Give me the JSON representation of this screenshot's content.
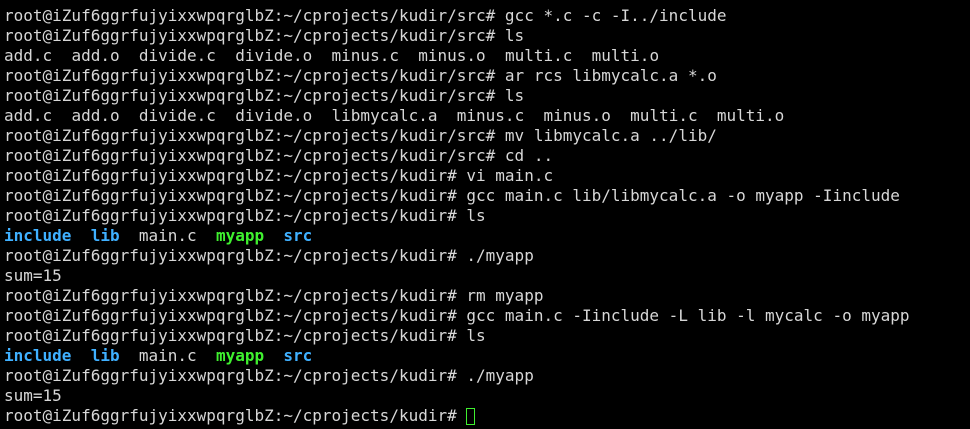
{
  "terminal": {
    "lines": [
      {
        "kind": "cmd",
        "prompt": "root@iZuf6ggrfujyixxwpqrglbZ:~/cprojects/kudir/src#",
        "command": "gcc *.c -c -I../include"
      },
      {
        "kind": "cmd",
        "prompt": "root@iZuf6ggrfujyixxwpqrglbZ:~/cprojects/kudir/src#",
        "command": "ls"
      },
      {
        "kind": "ls",
        "items": [
          {
            "text": "add.c",
            "type": "file"
          },
          {
            "text": "add.o",
            "type": "file"
          },
          {
            "text": "divide.c",
            "type": "file"
          },
          {
            "text": "divide.o",
            "type": "file"
          },
          {
            "text": "minus.c",
            "type": "file"
          },
          {
            "text": "minus.o",
            "type": "file"
          },
          {
            "text": "multi.c",
            "type": "file"
          },
          {
            "text": "multi.o",
            "type": "file"
          }
        ]
      },
      {
        "kind": "cmd",
        "prompt": "root@iZuf6ggrfujyixxwpqrglbZ:~/cprojects/kudir/src#",
        "command": "ar rcs libmycalc.a *.o"
      },
      {
        "kind": "cmd",
        "prompt": "root@iZuf6ggrfujyixxwpqrglbZ:~/cprojects/kudir/src#",
        "command": "ls"
      },
      {
        "kind": "ls",
        "items": [
          {
            "text": "add.c",
            "type": "file"
          },
          {
            "text": "add.o",
            "type": "file"
          },
          {
            "text": "divide.c",
            "type": "file"
          },
          {
            "text": "divide.o",
            "type": "file"
          },
          {
            "text": "libmycalc.a",
            "type": "file"
          },
          {
            "text": "minus.c",
            "type": "file"
          },
          {
            "text": "minus.o",
            "type": "file"
          },
          {
            "text": "multi.c",
            "type": "file"
          },
          {
            "text": "multi.o",
            "type": "file"
          }
        ]
      },
      {
        "kind": "cmd",
        "prompt": "root@iZuf6ggrfujyixxwpqrglbZ:~/cprojects/kudir/src#",
        "command": "mv libmycalc.a ../lib/"
      },
      {
        "kind": "cmd",
        "prompt": "root@iZuf6ggrfujyixxwpqrglbZ:~/cprojects/kudir/src#",
        "command": "cd .."
      },
      {
        "kind": "cmd",
        "prompt": "root@iZuf6ggrfujyixxwpqrglbZ:~/cprojects/kudir#",
        "command": "vi main.c"
      },
      {
        "kind": "cmd",
        "prompt": "root@iZuf6ggrfujyixxwpqrglbZ:~/cprojects/kudir#",
        "command": "gcc main.c lib/libmycalc.a -o myapp -Iinclude"
      },
      {
        "kind": "cmd",
        "prompt": "root@iZuf6ggrfujyixxwpqrglbZ:~/cprojects/kudir#",
        "command": "ls"
      },
      {
        "kind": "ls",
        "items": [
          {
            "text": "include",
            "type": "dir"
          },
          {
            "text": "lib",
            "type": "dir"
          },
          {
            "text": "main.c",
            "type": "file"
          },
          {
            "text": "myapp",
            "type": "exec"
          },
          {
            "text": "src",
            "type": "dir"
          }
        ]
      },
      {
        "kind": "cmd",
        "prompt": "root@iZuf6ggrfujyixxwpqrglbZ:~/cprojects/kudir#",
        "command": "./myapp"
      },
      {
        "kind": "out",
        "text": "sum=15"
      },
      {
        "kind": "cmd",
        "prompt": "root@iZuf6ggrfujyixxwpqrglbZ:~/cprojects/kudir#",
        "command": "rm myapp"
      },
      {
        "kind": "cmd",
        "prompt": "root@iZuf6ggrfujyixxwpqrglbZ:~/cprojects/kudir#",
        "command": "gcc main.c -Iinclude -L lib -l mycalc -o myapp"
      },
      {
        "kind": "cmd",
        "prompt": "root@iZuf6ggrfujyixxwpqrglbZ:~/cprojects/kudir#",
        "command": "ls"
      },
      {
        "kind": "ls",
        "items": [
          {
            "text": "include",
            "type": "dir"
          },
          {
            "text": "lib",
            "type": "dir"
          },
          {
            "text": "main.c",
            "type": "file"
          },
          {
            "text": "myapp",
            "type": "exec"
          },
          {
            "text": "src",
            "type": "dir"
          }
        ]
      },
      {
        "kind": "cmd",
        "prompt": "root@iZuf6ggrfujyixxwpqrglbZ:~/cprojects/kudir#",
        "command": "./myapp"
      },
      {
        "kind": "out",
        "text": "sum=15"
      },
      {
        "kind": "input",
        "prompt": "root@iZuf6ggrfujyixxwpqrglbZ:~/cprojects/kudir#",
        "command": ""
      }
    ]
  },
  "colors": {
    "background": "#000000",
    "text": "#d7d7d7",
    "directory": "#3fb0ff",
    "executable": "#3ff02f",
    "cursor": "#3ff02f"
  },
  "icons": {
    "cursor": "block-cursor-icon"
  }
}
